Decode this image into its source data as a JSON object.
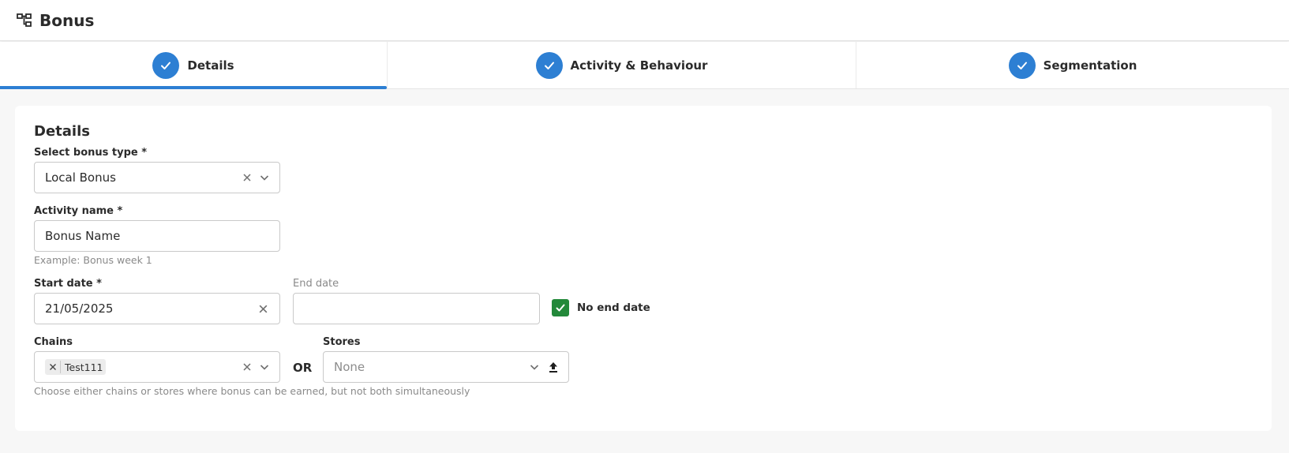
{
  "header": {
    "title": "Bonus",
    "icon": "hierarchy-icon"
  },
  "steps": [
    {
      "label": "Details",
      "completed": true,
      "active": true
    },
    {
      "label": "Activity & Behaviour",
      "completed": true,
      "active": false
    },
    {
      "label": "Segmentation",
      "completed": true,
      "active": false
    }
  ],
  "form": {
    "section_title": "Details",
    "bonus_type": {
      "label": "Select bonus type *",
      "value": "Local Bonus"
    },
    "activity_name": {
      "label": "Activity name *",
      "value": "Bonus Name",
      "hint": "Example: Bonus week 1"
    },
    "start_date": {
      "label": "Start date *",
      "value": "21/05/2025"
    },
    "end_date": {
      "label": "End date",
      "value": ""
    },
    "no_end_date": {
      "label": "No end date",
      "checked": true
    },
    "chains": {
      "label": "Chains",
      "chips": [
        "Test111"
      ]
    },
    "or_label": "OR",
    "stores": {
      "label": "Stores",
      "placeholder": "None"
    },
    "scope_hint": "Choose either chains or stores where bonus can be earned, but not both simultaneously"
  },
  "colors": {
    "accent": "#2d7fd3",
    "checkbox": "#23893a",
    "text": "#2b2b2b",
    "muted": "#8a8a8a"
  }
}
